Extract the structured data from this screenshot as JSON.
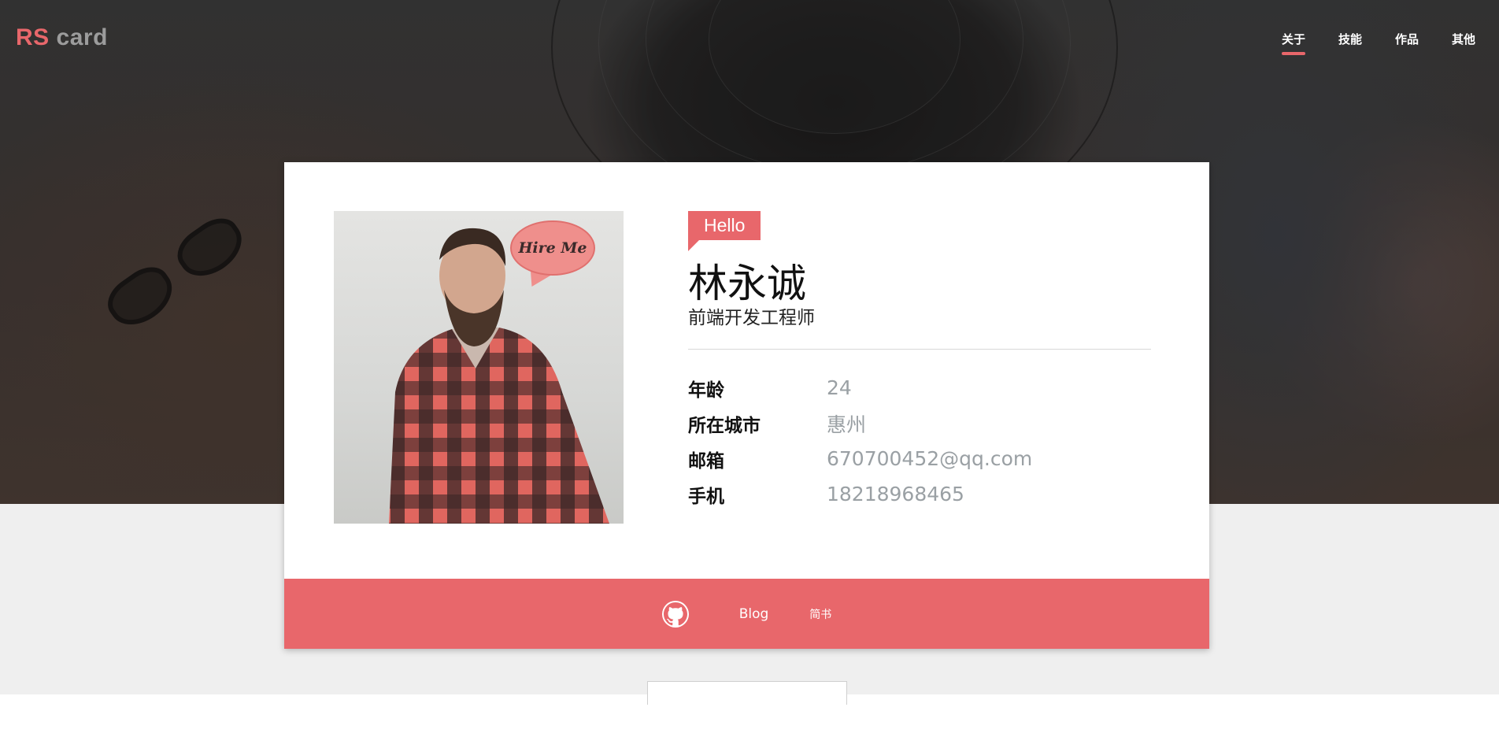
{
  "header": {
    "logo": {
      "rs": "RS",
      "card": "card"
    },
    "nav": [
      "关于",
      "技能",
      "作品",
      "其他"
    ],
    "active_nav": "关于"
  },
  "profile": {
    "photo_badge": "Hire Me",
    "greeting": "Hello",
    "name": "林永诚",
    "title": "前端开发工程师",
    "details": [
      {
        "label": "年龄",
        "value": "24"
      },
      {
        "label": "所在城市",
        "value": "惠州"
      },
      {
        "label": "邮箱",
        "value": "670700452@qq.com"
      },
      {
        "label": "手机",
        "value": "18218968465"
      }
    ]
  },
  "footer": {
    "github_icon": "github-icon",
    "blog": "Blog",
    "jianshu": "简书"
  },
  "colors": {
    "accent": "#e8676b",
    "logo_grey": "#9c9c9c",
    "value_grey": "#9aa0a4",
    "band_grey": "#efefef"
  }
}
